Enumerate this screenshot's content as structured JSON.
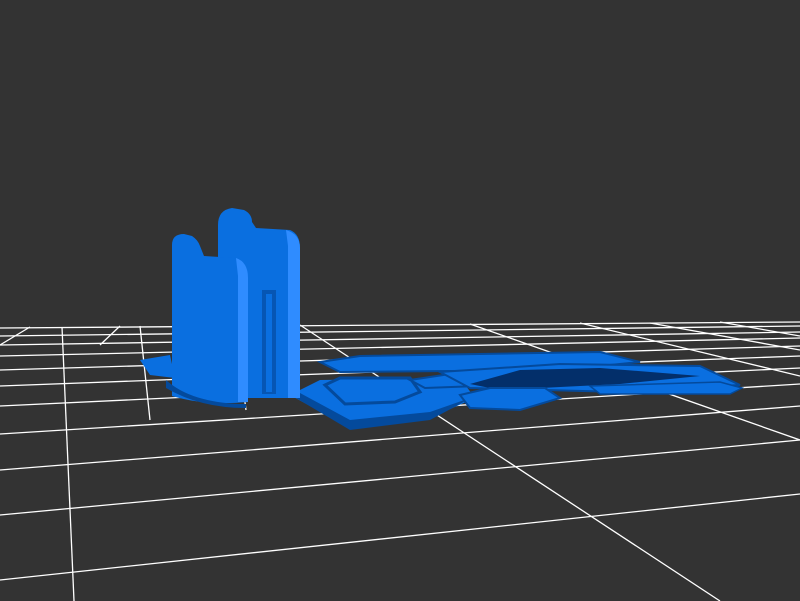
{
  "viewer": {
    "background_color": "#333333",
    "grid_color": "#ffffff",
    "model_color": "#0a6fe0",
    "model_shadow_color": "#044a9c",
    "model_highlight_color": "#2f8cff",
    "grid_visible": true
  }
}
